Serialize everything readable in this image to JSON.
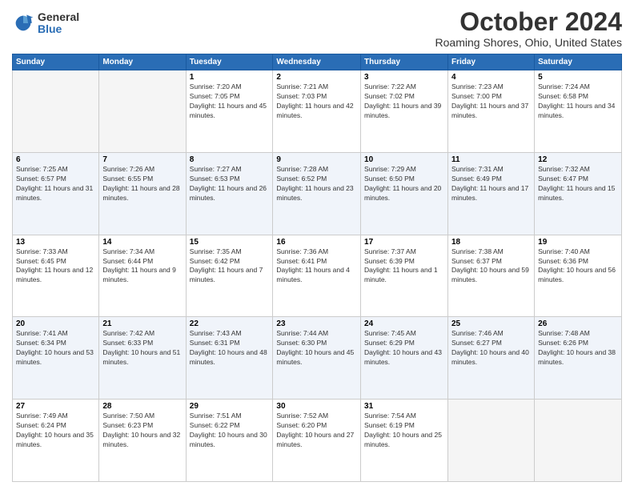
{
  "header": {
    "logo": {
      "general": "General",
      "blue": "Blue"
    },
    "title": "October 2024",
    "location": "Roaming Shores, Ohio, United States"
  },
  "calendar": {
    "days_of_week": [
      "Sunday",
      "Monday",
      "Tuesday",
      "Wednesday",
      "Thursday",
      "Friday",
      "Saturday"
    ],
    "weeks": [
      [
        {
          "day": "",
          "sunrise": "",
          "sunset": "",
          "daylight": ""
        },
        {
          "day": "",
          "sunrise": "",
          "sunset": "",
          "daylight": ""
        },
        {
          "day": "1",
          "sunrise": "Sunrise: 7:20 AM",
          "sunset": "Sunset: 7:05 PM",
          "daylight": "Daylight: 11 hours and 45 minutes."
        },
        {
          "day": "2",
          "sunrise": "Sunrise: 7:21 AM",
          "sunset": "Sunset: 7:03 PM",
          "daylight": "Daylight: 11 hours and 42 minutes."
        },
        {
          "day": "3",
          "sunrise": "Sunrise: 7:22 AM",
          "sunset": "Sunset: 7:02 PM",
          "daylight": "Daylight: 11 hours and 39 minutes."
        },
        {
          "day": "4",
          "sunrise": "Sunrise: 7:23 AM",
          "sunset": "Sunset: 7:00 PM",
          "daylight": "Daylight: 11 hours and 37 minutes."
        },
        {
          "day": "5",
          "sunrise": "Sunrise: 7:24 AM",
          "sunset": "Sunset: 6:58 PM",
          "daylight": "Daylight: 11 hours and 34 minutes."
        }
      ],
      [
        {
          "day": "6",
          "sunrise": "Sunrise: 7:25 AM",
          "sunset": "Sunset: 6:57 PM",
          "daylight": "Daylight: 11 hours and 31 minutes."
        },
        {
          "day": "7",
          "sunrise": "Sunrise: 7:26 AM",
          "sunset": "Sunset: 6:55 PM",
          "daylight": "Daylight: 11 hours and 28 minutes."
        },
        {
          "day": "8",
          "sunrise": "Sunrise: 7:27 AM",
          "sunset": "Sunset: 6:53 PM",
          "daylight": "Daylight: 11 hours and 26 minutes."
        },
        {
          "day": "9",
          "sunrise": "Sunrise: 7:28 AM",
          "sunset": "Sunset: 6:52 PM",
          "daylight": "Daylight: 11 hours and 23 minutes."
        },
        {
          "day": "10",
          "sunrise": "Sunrise: 7:29 AM",
          "sunset": "Sunset: 6:50 PM",
          "daylight": "Daylight: 11 hours and 20 minutes."
        },
        {
          "day": "11",
          "sunrise": "Sunrise: 7:31 AM",
          "sunset": "Sunset: 6:49 PM",
          "daylight": "Daylight: 11 hours and 17 minutes."
        },
        {
          "day": "12",
          "sunrise": "Sunrise: 7:32 AM",
          "sunset": "Sunset: 6:47 PM",
          "daylight": "Daylight: 11 hours and 15 minutes."
        }
      ],
      [
        {
          "day": "13",
          "sunrise": "Sunrise: 7:33 AM",
          "sunset": "Sunset: 6:45 PM",
          "daylight": "Daylight: 11 hours and 12 minutes."
        },
        {
          "day": "14",
          "sunrise": "Sunrise: 7:34 AM",
          "sunset": "Sunset: 6:44 PM",
          "daylight": "Daylight: 11 hours and 9 minutes."
        },
        {
          "day": "15",
          "sunrise": "Sunrise: 7:35 AM",
          "sunset": "Sunset: 6:42 PM",
          "daylight": "Daylight: 11 hours and 7 minutes."
        },
        {
          "day": "16",
          "sunrise": "Sunrise: 7:36 AM",
          "sunset": "Sunset: 6:41 PM",
          "daylight": "Daylight: 11 hours and 4 minutes."
        },
        {
          "day": "17",
          "sunrise": "Sunrise: 7:37 AM",
          "sunset": "Sunset: 6:39 PM",
          "daylight": "Daylight: 11 hours and 1 minute."
        },
        {
          "day": "18",
          "sunrise": "Sunrise: 7:38 AM",
          "sunset": "Sunset: 6:37 PM",
          "daylight": "Daylight: 10 hours and 59 minutes."
        },
        {
          "day": "19",
          "sunrise": "Sunrise: 7:40 AM",
          "sunset": "Sunset: 6:36 PM",
          "daylight": "Daylight: 10 hours and 56 minutes."
        }
      ],
      [
        {
          "day": "20",
          "sunrise": "Sunrise: 7:41 AM",
          "sunset": "Sunset: 6:34 PM",
          "daylight": "Daylight: 10 hours and 53 minutes."
        },
        {
          "day": "21",
          "sunrise": "Sunrise: 7:42 AM",
          "sunset": "Sunset: 6:33 PM",
          "daylight": "Daylight: 10 hours and 51 minutes."
        },
        {
          "day": "22",
          "sunrise": "Sunrise: 7:43 AM",
          "sunset": "Sunset: 6:31 PM",
          "daylight": "Daylight: 10 hours and 48 minutes."
        },
        {
          "day": "23",
          "sunrise": "Sunrise: 7:44 AM",
          "sunset": "Sunset: 6:30 PM",
          "daylight": "Daylight: 10 hours and 45 minutes."
        },
        {
          "day": "24",
          "sunrise": "Sunrise: 7:45 AM",
          "sunset": "Sunset: 6:29 PM",
          "daylight": "Daylight: 10 hours and 43 minutes."
        },
        {
          "day": "25",
          "sunrise": "Sunrise: 7:46 AM",
          "sunset": "Sunset: 6:27 PM",
          "daylight": "Daylight: 10 hours and 40 minutes."
        },
        {
          "day": "26",
          "sunrise": "Sunrise: 7:48 AM",
          "sunset": "Sunset: 6:26 PM",
          "daylight": "Daylight: 10 hours and 38 minutes."
        }
      ],
      [
        {
          "day": "27",
          "sunrise": "Sunrise: 7:49 AM",
          "sunset": "Sunset: 6:24 PM",
          "daylight": "Daylight: 10 hours and 35 minutes."
        },
        {
          "day": "28",
          "sunrise": "Sunrise: 7:50 AM",
          "sunset": "Sunset: 6:23 PM",
          "daylight": "Daylight: 10 hours and 32 minutes."
        },
        {
          "day": "29",
          "sunrise": "Sunrise: 7:51 AM",
          "sunset": "Sunset: 6:22 PM",
          "daylight": "Daylight: 10 hours and 30 minutes."
        },
        {
          "day": "30",
          "sunrise": "Sunrise: 7:52 AM",
          "sunset": "Sunset: 6:20 PM",
          "daylight": "Daylight: 10 hours and 27 minutes."
        },
        {
          "day": "31",
          "sunrise": "Sunrise: 7:54 AM",
          "sunset": "Sunset: 6:19 PM",
          "daylight": "Daylight: 10 hours and 25 minutes."
        },
        {
          "day": "",
          "sunrise": "",
          "sunset": "",
          "daylight": ""
        },
        {
          "day": "",
          "sunrise": "",
          "sunset": "",
          "daylight": ""
        }
      ]
    ]
  }
}
